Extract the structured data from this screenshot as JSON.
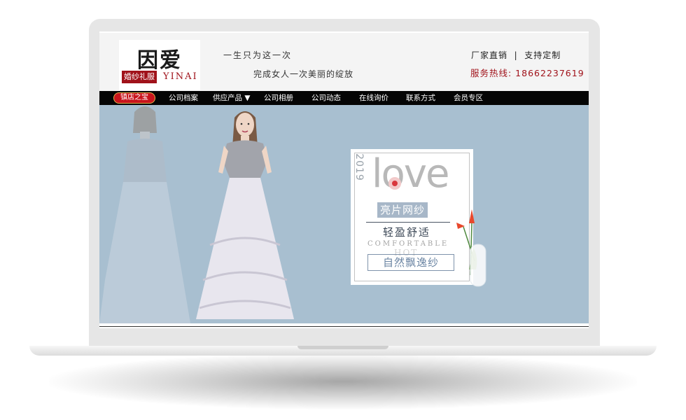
{
  "logo": {
    "title": "因爱",
    "subtitle_cn": "婚纱礼服",
    "subtitle_en": "YINAI"
  },
  "header": {
    "slogan_1": "一生只为这一次",
    "slogan_2": "完成女人一次美丽的绽放",
    "right_1": "厂家直销  |  支持定制",
    "right_2": "服务热线: 18662237619"
  },
  "nav": {
    "brand_label": "镇店之宝",
    "items": [
      "公司档案",
      "供应产品 ▼",
      "公司相册",
      "公司动态",
      "在线询价",
      "联系方式",
      "会员专区"
    ]
  },
  "banner": {
    "year": "2019",
    "headline": "love",
    "tag": "亮片网纱",
    "subtitle": "轻盈舒适",
    "english": "COMFORTABLE",
    "hot": "HOT",
    "button_text": "自然飘逸纱"
  },
  "colors": {
    "brand_red": "#a0121a",
    "nav_bg": "#050505",
    "banner_bg": "#a8bfd0"
  }
}
